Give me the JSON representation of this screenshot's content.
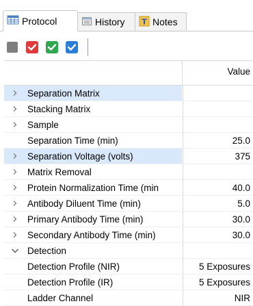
{
  "tabs": [
    {
      "label": "Protocol",
      "icon": "table-grid-icon",
      "active": true
    },
    {
      "label": "History",
      "icon": "history-window-icon",
      "active": false
    },
    {
      "label": "Notes",
      "icon": "notes-text-icon",
      "active": false
    }
  ],
  "toolbar": {
    "buttons": [
      {
        "name": "gray-square-icon",
        "color": "#7f7f7f"
      },
      {
        "name": "red-checkbox-icon",
        "color": "#e03a3a"
      },
      {
        "name": "green-checkbox-icon",
        "color": "#2fa84f"
      },
      {
        "name": "blue-checkbox-icon",
        "color": "#2b7fd9"
      }
    ]
  },
  "table": {
    "value_header": "Value",
    "rows": [
      {
        "label": "Separation Matrix",
        "value": "",
        "chevron": "right",
        "selected": true
      },
      {
        "label": "Stacking Matrix",
        "value": "",
        "chevron": "right"
      },
      {
        "label": "Sample",
        "value": "",
        "chevron": "right"
      },
      {
        "label": "Separation Time (min)",
        "value": "25.0",
        "chevron": "none"
      },
      {
        "label": "Separation Voltage (volts)",
        "value": "375",
        "chevron": "right",
        "selected": true
      },
      {
        "label": "Matrix Removal",
        "value": "",
        "chevron": "right"
      },
      {
        "label": "Protein Normalization Time (min",
        "value": "40.0",
        "chevron": "right"
      },
      {
        "label": "Antibody Diluent Time (min)",
        "value": "5.0",
        "chevron": "right"
      },
      {
        "label": "Primary Antibody Time (min)",
        "value": "30.0",
        "chevron": "right"
      },
      {
        "label": "Secondary Antibody Time (min)",
        "value": "30.0",
        "chevron": "right"
      },
      {
        "label": "Detection",
        "value": "",
        "chevron": "down"
      },
      {
        "label": "Detection Profile (NIR)",
        "value": "5 Exposures",
        "child": true
      },
      {
        "label": "Detection Profile (IR)",
        "value": "5 Exposures",
        "child": true
      },
      {
        "label": "Ladder Channel",
        "value": "NIR",
        "child": true
      }
    ]
  },
  "colors": {
    "selection": "#d9e8fb",
    "chevron": "#7a7a7a"
  }
}
